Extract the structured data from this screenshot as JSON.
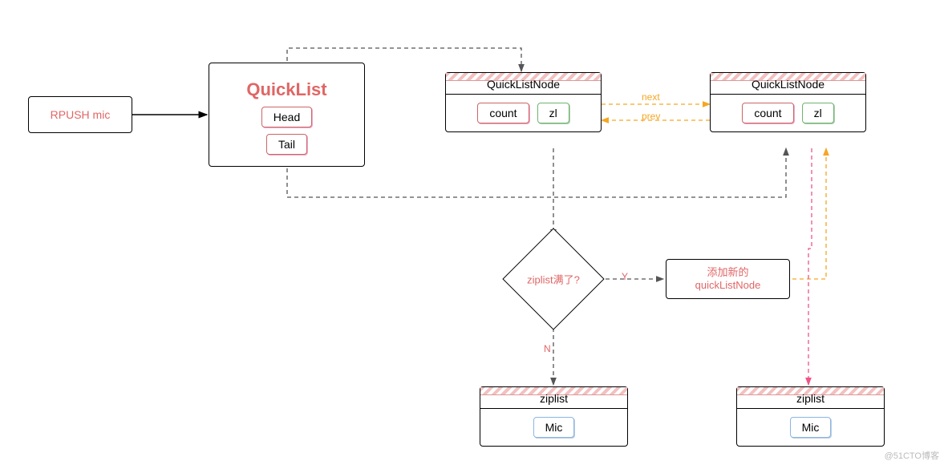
{
  "command": {
    "text": "RPUSH mic"
  },
  "quicklist": {
    "title": "QuickList",
    "head": "Head",
    "tail": "Tail"
  },
  "node1": {
    "title": "QuickListNode",
    "count": "count",
    "zl": "zl"
  },
  "node2": {
    "title": "QuickListNode",
    "count": "count",
    "zl": "zl"
  },
  "link": {
    "next": "next",
    "prev": "prev"
  },
  "decision": {
    "question": "ziplist满了?",
    "yes": "Y",
    "no": "N"
  },
  "addnode": {
    "line1": "添加新的",
    "line2": "quickListNode"
  },
  "ziplist1": {
    "title": "ziplist",
    "item": "Mic"
  },
  "ziplist2": {
    "title": "ziplist",
    "item": "Mic"
  },
  "watermark": "@51CTO博客"
}
